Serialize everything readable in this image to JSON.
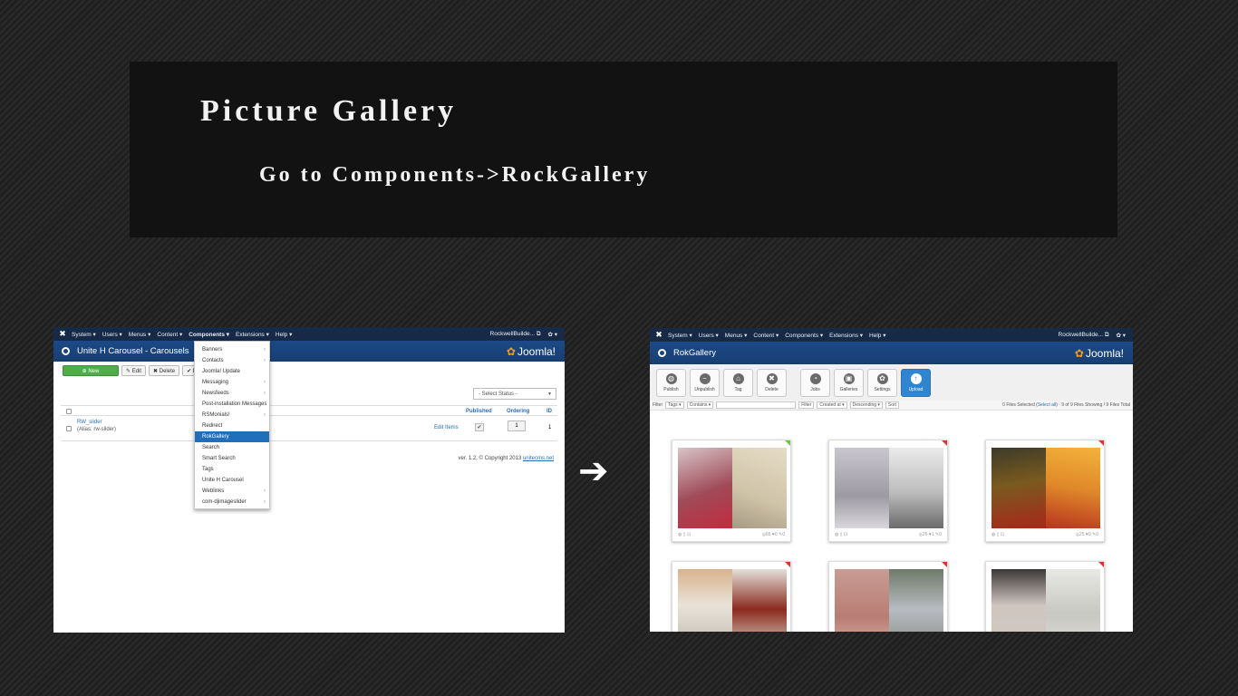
{
  "slide": {
    "title": "Picture Gallery",
    "subtitle": "Go to Components->RockGallery",
    "arrow": "➔"
  },
  "left_screen": {
    "topbar": {
      "logo": "✖",
      "menu": [
        "System ▾",
        "Users ▾",
        "Menus ▾",
        "Content ▾",
        "Components ▾",
        "Extensions ▾",
        "Help ▾"
      ],
      "site": "RockwellBuilde... ⧉",
      "gear": "✿ ▾"
    },
    "header": {
      "title": "Unite H Carousel - Carousels",
      "brand": "Joomla!"
    },
    "toolbar": {
      "new": "⊕ New",
      "edit": "✎ Edit",
      "delete": "✖ Delete",
      "publish": "✔ Pub"
    },
    "status_select": "- Select Status -",
    "table": {
      "headers": {
        "published": "Published",
        "ordering": "Ordering",
        "id": "ID"
      },
      "row": {
        "name": "RW_slider",
        "alias": "(Alias: rw-slider)",
        "edit_items": "Edit Items",
        "ordering": "1",
        "id": "1"
      }
    },
    "footer": {
      "version": "ver. 1.2, © Copyright 2013",
      "link": "unitecms.net"
    },
    "dropdown": {
      "items": [
        {
          "label": "Banners",
          "sub": "›"
        },
        {
          "label": "Contacts",
          "sub": "›"
        },
        {
          "label": "Joomla! Update",
          "sub": ""
        },
        {
          "label": "Messaging",
          "sub": "›"
        },
        {
          "label": "Newsfeeds",
          "sub": "›"
        },
        {
          "label": "Post-installation Messages",
          "sub": ""
        },
        {
          "label": "RSMonials!",
          "sub": "›"
        },
        {
          "label": "Redirect",
          "sub": ""
        },
        {
          "label": "RokGallery",
          "sub": ""
        },
        {
          "label": "Search",
          "sub": ""
        },
        {
          "label": "Smart Search",
          "sub": ""
        },
        {
          "label": "Tags",
          "sub": ""
        },
        {
          "label": "Unite H Carousel",
          "sub": ""
        },
        {
          "label": "Weblinks",
          "sub": "›"
        },
        {
          "label": "com-djimageslider",
          "sub": "›"
        }
      ]
    }
  },
  "right_screen": {
    "topbar": {
      "logo": "✖",
      "menu": [
        "System ▾",
        "Users ▾",
        "Menus ▾",
        "Content ▾",
        "Components ▾",
        "Extensions ▾",
        "Help ▾"
      ],
      "site": "RockwellBuilde... ⧉",
      "gear": "✿ ▾"
    },
    "header": {
      "title": "RokGallery",
      "brand": "Joomla!"
    },
    "toolbar": {
      "publish": "Publish",
      "unpublish": "Unpublish",
      "tag": "Tag",
      "delete": "Delete",
      "jobs": "Jobs",
      "galleries": "Galleries",
      "settings": "Settings",
      "upload": "Upload"
    },
    "filter": {
      "label": "Filter",
      "tags": "Tags ▾",
      "contains": "Contains ▾",
      "filter_btn": "Filter",
      "created": "Created at ▾",
      "descending": "Descending ▾",
      "sort": "Sort",
      "status_pre": "0 Files Selected (",
      "select_all": "Select all",
      "status_post": ") · 9 of 9 Files Showing / 9 Files Total"
    },
    "cards": [
      {
        "stats": "◎66 ♥0 ✎0"
      },
      {
        "stats": "◎26 ♥1 ✎0"
      },
      {
        "stats": "◎25 ♥0 ✎0"
      }
    ]
  }
}
